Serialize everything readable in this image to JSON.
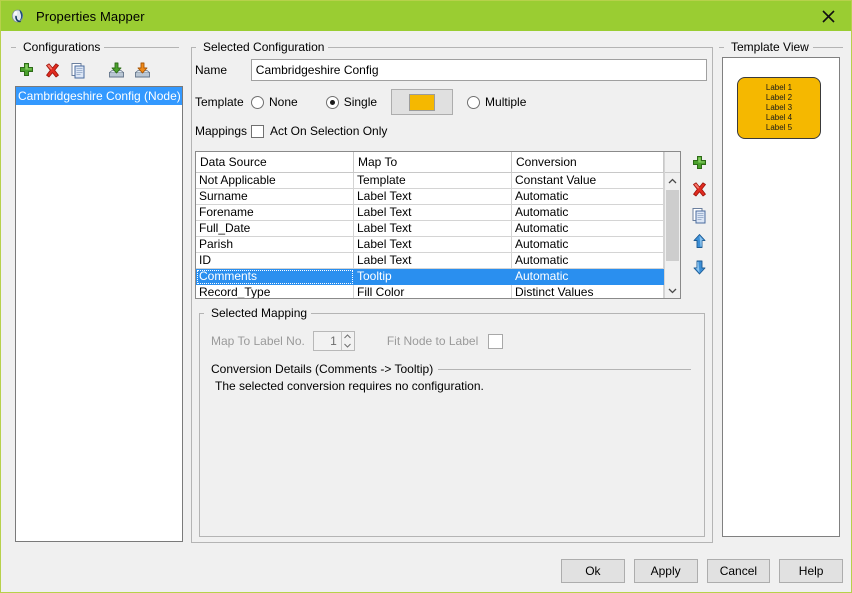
{
  "window": {
    "title": "Properties Mapper",
    "app_icon": "app-j-icon",
    "close_icon": "close-icon",
    "titlebar_color": "#9acd32",
    "background_color": "#f0f0f0"
  },
  "configurations": {
    "group_label": "Configurations",
    "toolbar": [
      {
        "name": "add-configuration-button",
        "icon": "plus-icon"
      },
      {
        "name": "delete-configuration-button",
        "icon": "delete-x-icon"
      },
      {
        "name": "copy-configuration-button",
        "icon": "copy-icon"
      },
      {
        "name": "import-configuration-button",
        "icon": "import-icon"
      },
      {
        "name": "export-configuration-button",
        "icon": "export-icon"
      }
    ],
    "items": [
      {
        "label": "Cambridgeshire Config (Node)",
        "selected": true
      }
    ]
  },
  "selected_configuration": {
    "group_label": "Selected Configuration",
    "name_label": "Name",
    "name_value": "Cambridgeshire Config",
    "name_placeholder": "",
    "template_label": "Template",
    "template_options": [
      {
        "label": "None",
        "checked": false
      },
      {
        "label": "Single",
        "checked": true
      },
      {
        "label": "Multiple",
        "checked": false
      }
    ],
    "template_color": "#f5b800",
    "mappings_label": "Mappings",
    "act_on_selection_label": "Act On Selection Only",
    "act_on_selection_checked": false,
    "table": {
      "columns": [
        "Data Source",
        "Map To",
        "Conversion"
      ],
      "rows": [
        {
          "data_source": "Not Applicable",
          "map_to": "Template",
          "conversion": "Constant Value",
          "selected": false
        },
        {
          "data_source": "Surname",
          "map_to": "Label Text",
          "conversion": "Automatic",
          "selected": false
        },
        {
          "data_source": "Forename",
          "map_to": "Label Text",
          "conversion": "Automatic",
          "selected": false
        },
        {
          "data_source": "Full_Date",
          "map_to": "Label Text",
          "conversion": "Automatic",
          "selected": false
        },
        {
          "data_source": "Parish",
          "map_to": "Label Text",
          "conversion": "Automatic",
          "selected": false
        },
        {
          "data_source": "ID",
          "map_to": "Label Text",
          "conversion": "Automatic",
          "selected": false
        },
        {
          "data_source": "Comments",
          "map_to": "Tooltip",
          "conversion": "Automatic",
          "selected": true
        },
        {
          "data_source": "Record_Type",
          "map_to": "Fill Color",
          "conversion": "Distinct Values",
          "selected": false
        }
      ],
      "buttons": [
        {
          "name": "add-mapping-button",
          "icon": "plus-icon"
        },
        {
          "name": "delete-mapping-button",
          "icon": "delete-x-icon"
        },
        {
          "name": "copy-mapping-button",
          "icon": "copy-icon"
        },
        {
          "name": "move-mapping-up-button",
          "icon": "arrow-up-icon"
        },
        {
          "name": "move-mapping-down-button",
          "icon": "arrow-down-icon"
        }
      ],
      "scrollbar": {
        "up_icon": "chevron-up-icon",
        "down_icon": "chevron-down-icon"
      }
    }
  },
  "selected_mapping": {
    "group_label": "Selected Mapping",
    "map_to_label_no_label": "Map To Label No.",
    "map_to_label_no_value": "1",
    "map_to_label_no_disabled": true,
    "fit_node_to_label_label": "Fit Node to Label",
    "fit_node_to_label_checked": false,
    "fit_node_to_label_disabled": true,
    "conversion_details_label": "Conversion Details (Comments -> Tooltip)",
    "conversion_details_text": "The selected conversion requires no configuration."
  },
  "template_view": {
    "group_label": "Template View",
    "node_fill": "#f5b800",
    "node_labels": [
      "Label 1",
      "Label 2",
      "Label 3",
      "Label 4",
      "Label 5"
    ]
  },
  "dialog_buttons": [
    {
      "label": "Ok",
      "name": "ok-button"
    },
    {
      "label": "Apply",
      "name": "apply-button"
    },
    {
      "label": "Cancel",
      "name": "cancel-button"
    },
    {
      "label": "Help",
      "name": "help-button"
    }
  ]
}
